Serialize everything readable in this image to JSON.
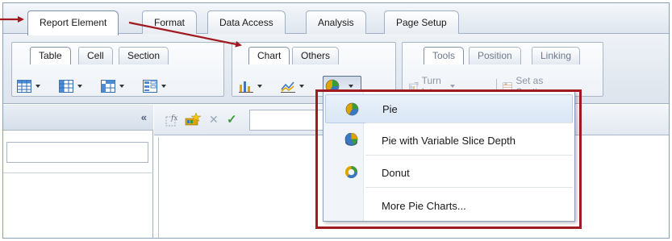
{
  "main_tabs": [
    {
      "label": "Report Element",
      "active": true
    },
    {
      "label": "Format",
      "active": false
    },
    {
      "label": "Data Access",
      "active": false
    },
    {
      "label": "Analysis",
      "active": false
    },
    {
      "label": "Page Setup",
      "active": false
    }
  ],
  "ribbon": {
    "table_group": {
      "tabs": [
        "Table",
        "Cell",
        "Section"
      ]
    },
    "chart_group": {
      "tabs": [
        "Chart",
        "Others"
      ]
    },
    "tools_group": {
      "tabs": [
        "Tools",
        "Position",
        "Linking"
      ],
      "turn_into_label": "Turn Into",
      "set_as_section_label": "Set as Section"
    }
  },
  "menu": {
    "items": [
      {
        "label": "Pie",
        "icon": "pie-chart-icon"
      },
      {
        "label": "Pie with Variable Slice Depth",
        "icon": "pie-depth-chart-icon"
      },
      {
        "label": "Donut",
        "icon": "donut-chart-icon"
      },
      {
        "label": "More Pie Charts...",
        "icon": ""
      }
    ]
  },
  "colors": {
    "annotation": "#a01a20",
    "ribbon_bg": "#dfe6ef",
    "border": "#9fb0c6"
  }
}
